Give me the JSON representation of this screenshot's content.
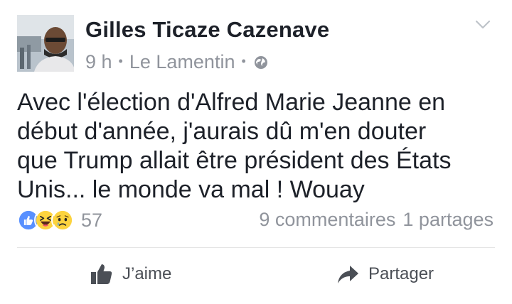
{
  "post": {
    "author": "Gilles Ticaze Cazenave",
    "time": "9 h",
    "separator": "•",
    "location": "Le Lamentin",
    "message": "Avec l'élection d'Alfred Marie Jeanne en\ndébut d'année,  j'aurais dû m'en douter\nque Trump allait être président des États\nUnis... le monde va mal ! Wouay",
    "reactions": {
      "types": [
        "like-icon",
        "haha-icon",
        "sad-icon"
      ],
      "count": "57"
    },
    "comments_label": "9 commentaires",
    "shares_label": "1 partages"
  },
  "actions": {
    "like_label": "J’aime",
    "share_label": "Partager"
  },
  "colors": {
    "like_blue": "#5890ff",
    "emoji_yellow": "#fcd33f",
    "text": "#1d2129",
    "muted": "#90949c"
  }
}
